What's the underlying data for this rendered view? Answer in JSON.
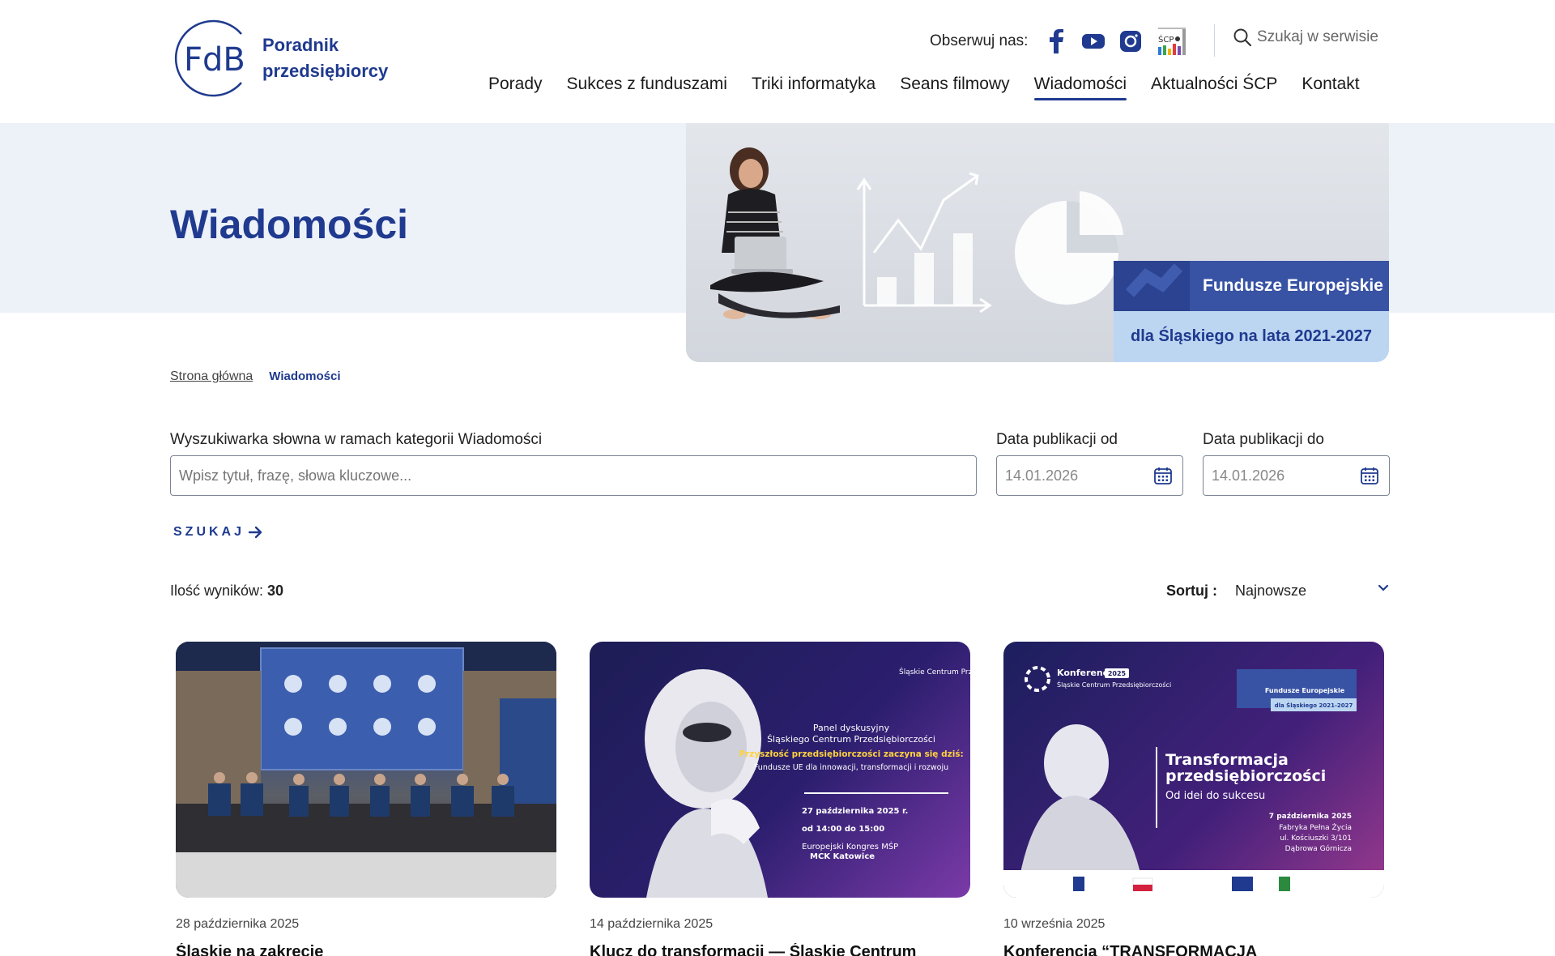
{
  "header": {
    "logo_mark": "FdB",
    "logo_line1": "Poradnik",
    "logo_line2": "przedsiębiorcy",
    "follow_label": "Obserwuj nas:",
    "social": [
      "facebook-icon",
      "youtube-icon",
      "instagram-icon",
      "scp-icon"
    ],
    "scp_label": "ŚCP",
    "search_placeholder": "Szukaj w serwisie",
    "nav": [
      "Porady",
      "Sukces z funduszami",
      "Triki informatyka",
      "Seans filmowy",
      "Wiadomości",
      "Aktualności ŚCP",
      "Kontakt"
    ],
    "active_nav": "Wiadomości"
  },
  "hero": {
    "title": "Wiadomości",
    "badge_top": "Fundusze Europejskie",
    "badge_bottom": "dla Śląskiego na lata 2021-2027"
  },
  "breadcrumb": {
    "home": "Strona główna",
    "current": "Wiadomości"
  },
  "search": {
    "keyword_label": "Wyszukiwarka słowna w ramach kategorii Wiadomości",
    "keyword_placeholder": "Wpisz tytuł, frazę, słowa kluczowe...",
    "date_from_label": "Data publikacji od",
    "date_from_value": "14.01.2026",
    "date_to_label": "Data publikacji do",
    "date_to_value": "14.01.2026",
    "submit_label": "SZUKAJ"
  },
  "results": {
    "count_label": "Ilość wyników:",
    "count": "30",
    "sort_label": "Sortuj :",
    "sort_value": "Najnowsze"
  },
  "cards": [
    {
      "date": "28 października 2025",
      "title": "Śląskie na zakręcie"
    },
    {
      "date": "14 października 2025",
      "title": "Klucz do transformacji — Śląskie Centrum",
      "img_header": "Śląskie Centrum Przedsiębiorczości",
      "img_line1": "Panel dyskusyjny",
      "img_line2": "Śląskiego Centrum Przedsiębiorczości",
      "img_yellow": "Przyszłość przedsiębiorczości zaczyna się dziś:",
      "img_sub": "Fundusze UE dla innowacji, transformacji i rozwoju",
      "img_date": "27 października 2025 r.",
      "img_time": "od 14:00 do 15:00",
      "img_place1": "Europejski Kongres MŚP",
      "img_place2": "MCK Katowice"
    },
    {
      "date": "10 września 2025",
      "title": "Konferencja “TRANSFORMACJA",
      "img_conf": "Konferencja",
      "img_conf_year": "2025",
      "img_org": "Śląskie Centrum Przedsiębiorczości",
      "img_fe": "Fundusze Europejskie",
      "img_fe_sub": "dla Śląskiego 2021-2027",
      "img_title1": "Transformacja",
      "img_title2": "przedsiębiorczości",
      "img_subtitle": "Od idei do sukcesu",
      "img_date": "7 października 2025",
      "img_place1": "Fabryka Pełna Życia",
      "img_place2": "ul. Kościuszki 3/101",
      "img_place3": "Dąbrowa Górnicza"
    }
  ],
  "colors": {
    "brand": "#1f3a8f",
    "hero_band": "#edf1f8",
    "eu_blue": "#3853a4",
    "eu_light": "#bcd6f2"
  }
}
